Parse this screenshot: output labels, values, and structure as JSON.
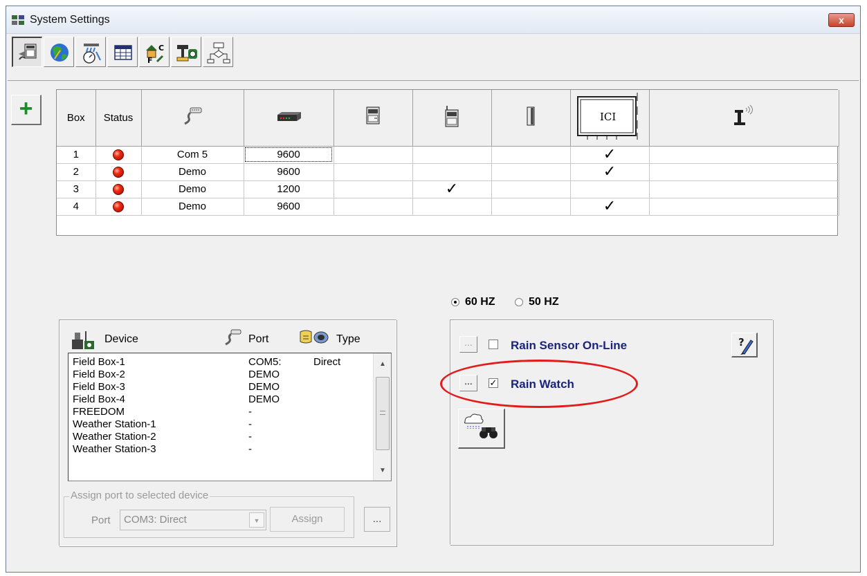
{
  "window": {
    "title": "System Settings",
    "close_label": "x"
  },
  "toolbar": {
    "buttons": [
      {
        "name": "field-box-settings"
      },
      {
        "name": "world-map"
      },
      {
        "name": "rain-gauge"
      },
      {
        "name": "schedule-table"
      },
      {
        "name": "units"
      },
      {
        "name": "ruler-camera"
      },
      {
        "name": "flowchart"
      }
    ]
  },
  "grid": {
    "headers": [
      "Box",
      "Status"
    ],
    "rows": [
      {
        "box": "1",
        "port": "Com 5",
        "baud": "9600",
        "col6": "",
        "col7": "",
        "ici": "✓",
        "col9": ""
      },
      {
        "box": "2",
        "port": "Demo",
        "baud": "9600",
        "col6": "",
        "col7": "",
        "ici": "✓",
        "col9": ""
      },
      {
        "box": "3",
        "port": "Demo",
        "baud": "1200",
        "col6": "✓",
        "col7": "",
        "ici": "",
        "col9": ""
      },
      {
        "box": "4",
        "port": "Demo",
        "baud": "9600",
        "col6": "",
        "col7": "",
        "ici": "✓",
        "col9": ""
      }
    ],
    "ici_label": "ICI",
    "status_color": "#f02b10"
  },
  "frequency": {
    "opt60": "60 HZ",
    "opt50": "50 HZ",
    "selected": "60 HZ"
  },
  "rain": {
    "sensor_label": "Rain Sensor On-Line",
    "sensor_checked": "",
    "watch_label": "Rain Watch",
    "watch_checked": "✓",
    "ellipsis": "...",
    "highlight_color": "#e31b1b"
  },
  "devices": {
    "headers": {
      "device": "Device",
      "port": "Port",
      "type": "Type"
    },
    "rows": [
      {
        "device": "Field Box-1",
        "port": "COM5:",
        "type": "Direct"
      },
      {
        "device": "Field Box-2",
        "port": "DEMO",
        "type": ""
      },
      {
        "device": "Field Box-3",
        "port": "DEMO",
        "type": ""
      },
      {
        "device": "Field Box-4",
        "port": "DEMO",
        "type": ""
      },
      {
        "device": "FREEDOM",
        "port": "-",
        "type": ""
      },
      {
        "device": "Weather Station-1",
        "port": "-",
        "type": ""
      },
      {
        "device": "Weather Station-2",
        "port": "-",
        "type": ""
      },
      {
        "device": "Weather Station-3",
        "port": "-",
        "type": ""
      }
    ]
  },
  "assign": {
    "legend": "Assign port to selected device",
    "port_label": "Port",
    "port_value": "COM3: Direct",
    "assign_label": "Assign",
    "ellipsis": "..."
  }
}
